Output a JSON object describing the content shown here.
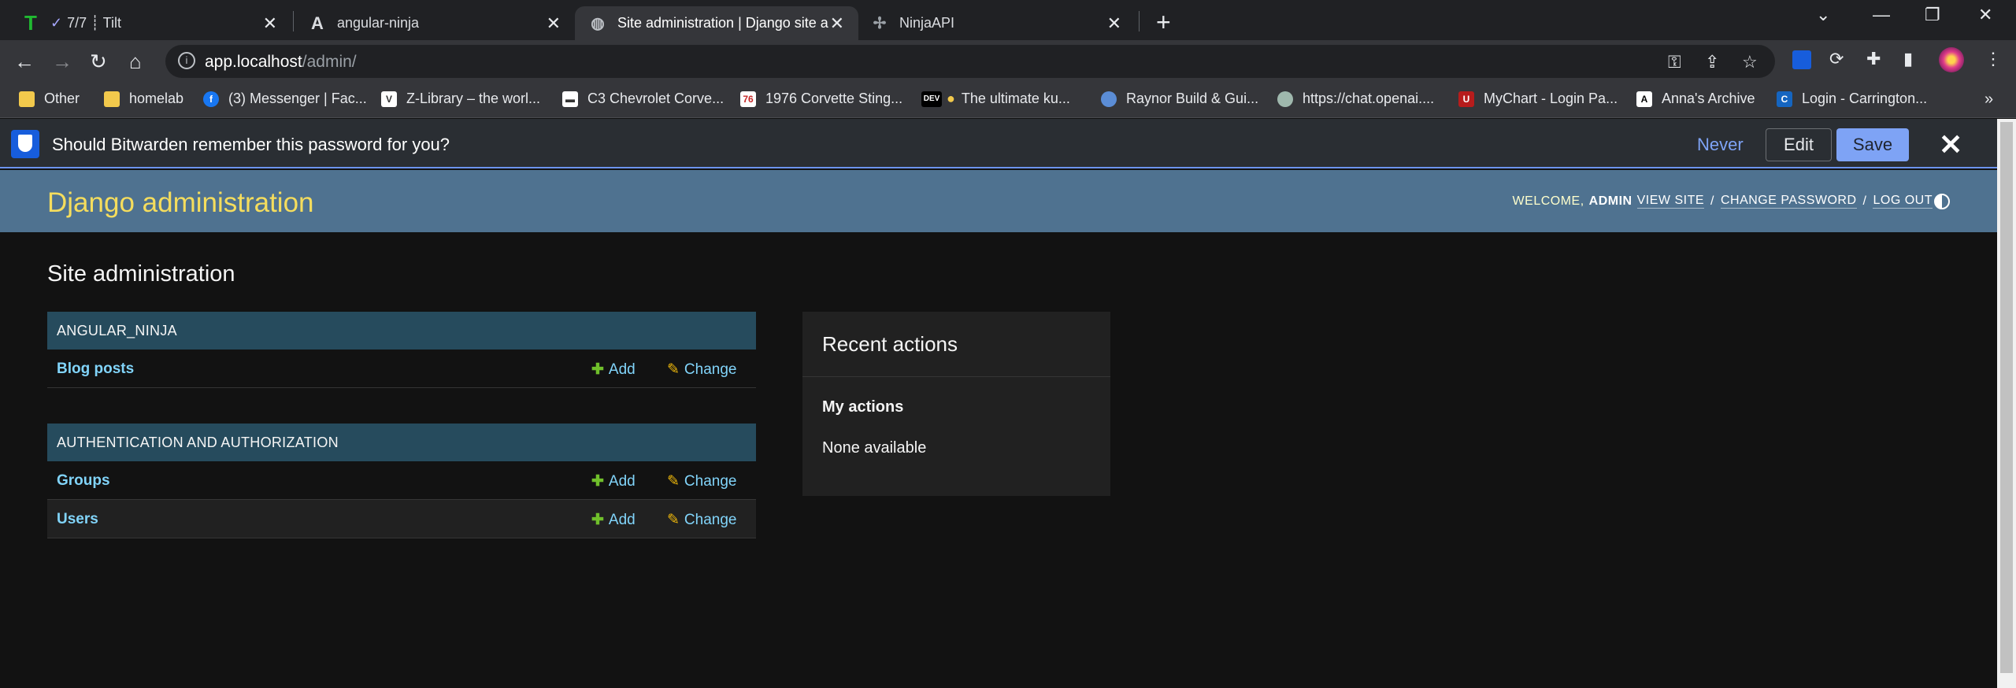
{
  "browser": {
    "tabs": [
      {
        "title": "7/7 ┊ Tilt",
        "icon": "tilt-icon",
        "active": false
      },
      {
        "title": "angular-ninja",
        "icon": "angular-icon",
        "active": false
      },
      {
        "title": "Site administration | Django site a",
        "icon": "globe-icon",
        "active": true
      },
      {
        "title": "NinjaAPI",
        "icon": "ninja-icon",
        "active": false
      }
    ],
    "url_host": "app.localhost",
    "url_path": "/admin/",
    "bookmarks": [
      {
        "label": "Other",
        "icon": "folder-icon"
      },
      {
        "label": "homelab",
        "icon": "folder-icon"
      },
      {
        "label": "(3) Messenger | Fac...",
        "icon": "facebook-icon"
      },
      {
        "label": "Z-Library – the worl...",
        "icon": "zlibrary-icon"
      },
      {
        "label": "C3 Chevrolet Corve...",
        "icon": "chevrolet-icon"
      },
      {
        "label": "1976 Corvette Sting...",
        "icon": "corvette-icon"
      },
      {
        "label": "The ultimate ku...",
        "icon": "dev-icon"
      },
      {
        "label": "Raynor Build & Gui...",
        "icon": "raynor-icon"
      },
      {
        "label": "https://chat.openai....",
        "icon": "openai-icon"
      },
      {
        "label": "MyChart - Login Pa...",
        "icon": "mychart-icon"
      },
      {
        "label": "Anna's Archive",
        "icon": "annas-archive-icon"
      },
      {
        "label": "Login - Carrington...",
        "icon": "carrington-icon"
      }
    ]
  },
  "bitwarden": {
    "prompt": "Should Bitwarden remember this password for you?",
    "never_label": "Never",
    "edit_label": "Edit",
    "save_label": "Save"
  },
  "django": {
    "brand": "Django administration",
    "welcome": "WELCOME,",
    "username": "ADMIN",
    "view_site": "VIEW SITE",
    "change_password": "CHANGE PASSWORD",
    "log_out": "LOG OUT",
    "page_title": "Site administration",
    "modules": [
      {
        "caption": "ANGULAR_NINJA",
        "models": [
          {
            "name": "Blog posts",
            "add": "Add",
            "change": "Change"
          }
        ]
      },
      {
        "caption": "AUTHENTICATION AND AUTHORIZATION",
        "models": [
          {
            "name": "Groups",
            "add": "Add",
            "change": "Change"
          },
          {
            "name": "Users",
            "add": "Add",
            "change": "Change"
          }
        ]
      }
    ],
    "recent": {
      "title": "Recent actions",
      "subtitle": "My actions",
      "empty": "None available"
    }
  },
  "colors": {
    "header_bg": "#4f7290",
    "brand_text": "#f5dd5d",
    "link": "#81d4fa",
    "add_icon": "#70bf2b",
    "change_icon": "#efb80b",
    "bitwarden_accent": "#7ea3f5"
  }
}
